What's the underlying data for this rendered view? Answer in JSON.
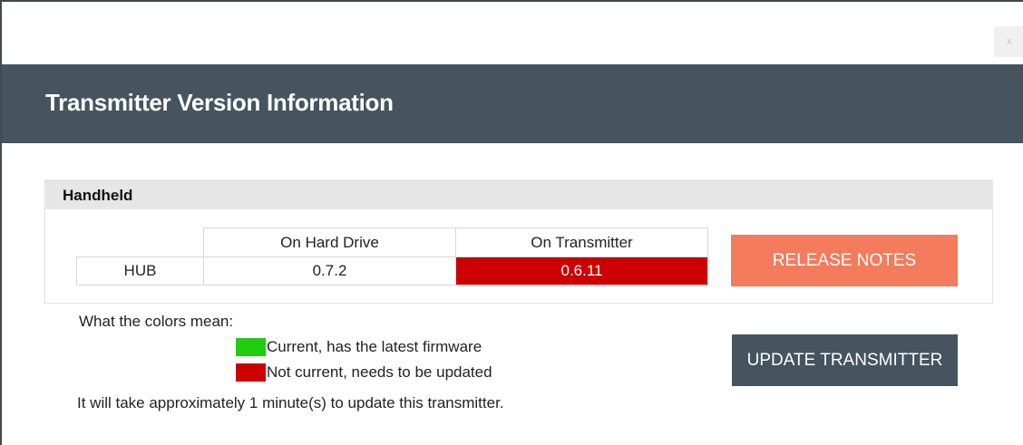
{
  "window": {
    "close_label": "x"
  },
  "header": {
    "title": "Transmitter Version Information"
  },
  "group": {
    "title": "Handheld",
    "table": {
      "columns": [
        "",
        "On Hard Drive",
        "On Transmitter"
      ],
      "rows": [
        {
          "label": "HUB",
          "hard_drive": "0.7.2",
          "transmitter": "0.6.11",
          "transmitter_status": "not-current"
        }
      ]
    },
    "release_notes_label": "RELEASE NOTES"
  },
  "legend": {
    "heading": "What the colors mean:",
    "items": [
      {
        "label": "Current, has the latest firmware",
        "color": "#22cc11"
      },
      {
        "label": "Not current, needs to be updated",
        "color": "#cc0000"
      }
    ]
  },
  "update_label": "UPDATE TRANSMITTER",
  "note": "It will take approximately 1 minute(s) to update this transmitter.",
  "colors": {
    "header": "#45545e",
    "release_button": "#f47b5c",
    "update_button": "#45545e",
    "outdated": "#cc0000",
    "current": "#22cc11"
  }
}
